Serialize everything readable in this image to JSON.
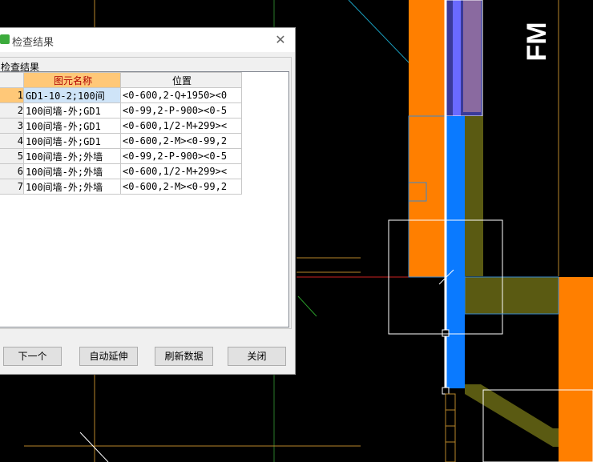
{
  "cad": {
    "fm_label": "FM"
  },
  "dialog": {
    "title": "检查结果",
    "group_label": "检查结果",
    "table": {
      "headers": [
        "图元名称",
        "位置"
      ],
      "rows": [
        {
          "num": "1",
          "name": "GD1-10-2;100间",
          "position": "<0-600,2-Q+1950><0"
        },
        {
          "num": "2",
          "name": "100间墙-外;GD1",
          "position": "<0-99,2-P-900><0-5"
        },
        {
          "num": "3",
          "name": "100间墙-外;GD1",
          "position": "<0-600,1/2-M+299><"
        },
        {
          "num": "4",
          "name": "100间墙-外;GD1",
          "position": "<0-600,2-M><0-99,2"
        },
        {
          "num": "5",
          "name": "100间墙-外;外墙",
          "position": "<0-99,2-P-900><0-5"
        },
        {
          "num": "6",
          "name": "100间墙-外;外墙",
          "position": "<0-600,1/2-M+299><"
        },
        {
          "num": "7",
          "name": "100间墙-外;外墙",
          "position": "<0-600,2-M><0-99,2"
        }
      ]
    },
    "buttons": {
      "next": "下一个",
      "auto_extend": "自动延伸",
      "refresh": "刷新数据",
      "close": "关闭"
    }
  }
}
